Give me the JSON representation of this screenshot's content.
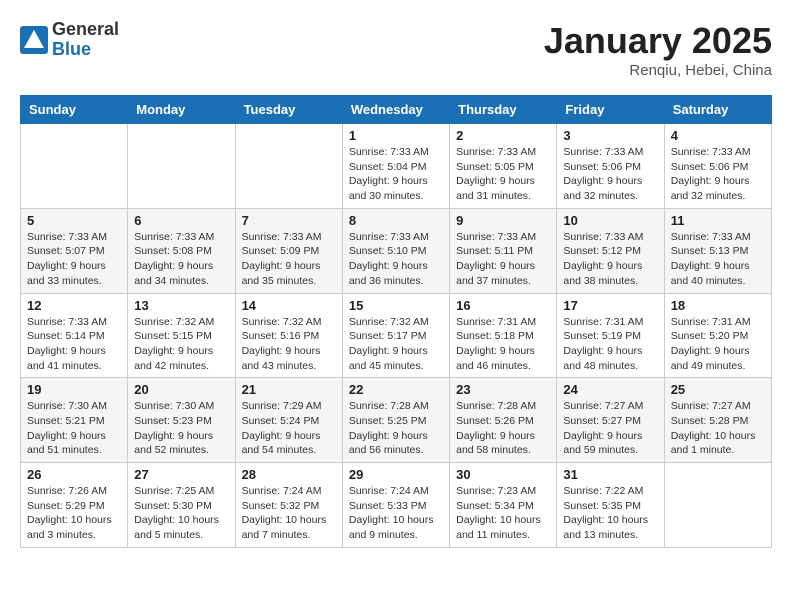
{
  "logo": {
    "general": "General",
    "blue": "Blue"
  },
  "title": "January 2025",
  "location": "Renqiu, Hebei, China",
  "weekdays": [
    "Sunday",
    "Monday",
    "Tuesday",
    "Wednesday",
    "Thursday",
    "Friday",
    "Saturday"
  ],
  "weeks": [
    [
      {
        "day": "",
        "info": ""
      },
      {
        "day": "",
        "info": ""
      },
      {
        "day": "",
        "info": ""
      },
      {
        "day": "1",
        "info": "Sunrise: 7:33 AM\nSunset: 5:04 PM\nDaylight: 9 hours\nand 30 minutes."
      },
      {
        "day": "2",
        "info": "Sunrise: 7:33 AM\nSunset: 5:05 PM\nDaylight: 9 hours\nand 31 minutes."
      },
      {
        "day": "3",
        "info": "Sunrise: 7:33 AM\nSunset: 5:06 PM\nDaylight: 9 hours\nand 32 minutes."
      },
      {
        "day": "4",
        "info": "Sunrise: 7:33 AM\nSunset: 5:06 PM\nDaylight: 9 hours\nand 32 minutes."
      }
    ],
    [
      {
        "day": "5",
        "info": "Sunrise: 7:33 AM\nSunset: 5:07 PM\nDaylight: 9 hours\nand 33 minutes."
      },
      {
        "day": "6",
        "info": "Sunrise: 7:33 AM\nSunset: 5:08 PM\nDaylight: 9 hours\nand 34 minutes."
      },
      {
        "day": "7",
        "info": "Sunrise: 7:33 AM\nSunset: 5:09 PM\nDaylight: 9 hours\nand 35 minutes."
      },
      {
        "day": "8",
        "info": "Sunrise: 7:33 AM\nSunset: 5:10 PM\nDaylight: 9 hours\nand 36 minutes."
      },
      {
        "day": "9",
        "info": "Sunrise: 7:33 AM\nSunset: 5:11 PM\nDaylight: 9 hours\nand 37 minutes."
      },
      {
        "day": "10",
        "info": "Sunrise: 7:33 AM\nSunset: 5:12 PM\nDaylight: 9 hours\nand 38 minutes."
      },
      {
        "day": "11",
        "info": "Sunrise: 7:33 AM\nSunset: 5:13 PM\nDaylight: 9 hours\nand 40 minutes."
      }
    ],
    [
      {
        "day": "12",
        "info": "Sunrise: 7:33 AM\nSunset: 5:14 PM\nDaylight: 9 hours\nand 41 minutes."
      },
      {
        "day": "13",
        "info": "Sunrise: 7:32 AM\nSunset: 5:15 PM\nDaylight: 9 hours\nand 42 minutes."
      },
      {
        "day": "14",
        "info": "Sunrise: 7:32 AM\nSunset: 5:16 PM\nDaylight: 9 hours\nand 43 minutes."
      },
      {
        "day": "15",
        "info": "Sunrise: 7:32 AM\nSunset: 5:17 PM\nDaylight: 9 hours\nand 45 minutes."
      },
      {
        "day": "16",
        "info": "Sunrise: 7:31 AM\nSunset: 5:18 PM\nDaylight: 9 hours\nand 46 minutes."
      },
      {
        "day": "17",
        "info": "Sunrise: 7:31 AM\nSunset: 5:19 PM\nDaylight: 9 hours\nand 48 minutes."
      },
      {
        "day": "18",
        "info": "Sunrise: 7:31 AM\nSunset: 5:20 PM\nDaylight: 9 hours\nand 49 minutes."
      }
    ],
    [
      {
        "day": "19",
        "info": "Sunrise: 7:30 AM\nSunset: 5:21 PM\nDaylight: 9 hours\nand 51 minutes."
      },
      {
        "day": "20",
        "info": "Sunrise: 7:30 AM\nSunset: 5:23 PM\nDaylight: 9 hours\nand 52 minutes."
      },
      {
        "day": "21",
        "info": "Sunrise: 7:29 AM\nSunset: 5:24 PM\nDaylight: 9 hours\nand 54 minutes."
      },
      {
        "day": "22",
        "info": "Sunrise: 7:28 AM\nSunset: 5:25 PM\nDaylight: 9 hours\nand 56 minutes."
      },
      {
        "day": "23",
        "info": "Sunrise: 7:28 AM\nSunset: 5:26 PM\nDaylight: 9 hours\nand 58 minutes."
      },
      {
        "day": "24",
        "info": "Sunrise: 7:27 AM\nSunset: 5:27 PM\nDaylight: 9 hours\nand 59 minutes."
      },
      {
        "day": "25",
        "info": "Sunrise: 7:27 AM\nSunset: 5:28 PM\nDaylight: 10 hours\nand 1 minute."
      }
    ],
    [
      {
        "day": "26",
        "info": "Sunrise: 7:26 AM\nSunset: 5:29 PM\nDaylight: 10 hours\nand 3 minutes."
      },
      {
        "day": "27",
        "info": "Sunrise: 7:25 AM\nSunset: 5:30 PM\nDaylight: 10 hours\nand 5 minutes."
      },
      {
        "day": "28",
        "info": "Sunrise: 7:24 AM\nSunset: 5:32 PM\nDaylight: 10 hours\nand 7 minutes."
      },
      {
        "day": "29",
        "info": "Sunrise: 7:24 AM\nSunset: 5:33 PM\nDaylight: 10 hours\nand 9 minutes."
      },
      {
        "day": "30",
        "info": "Sunrise: 7:23 AM\nSunset: 5:34 PM\nDaylight: 10 hours\nand 11 minutes."
      },
      {
        "day": "31",
        "info": "Sunrise: 7:22 AM\nSunset: 5:35 PM\nDaylight: 10 hours\nand 13 minutes."
      },
      {
        "day": "",
        "info": ""
      }
    ]
  ]
}
